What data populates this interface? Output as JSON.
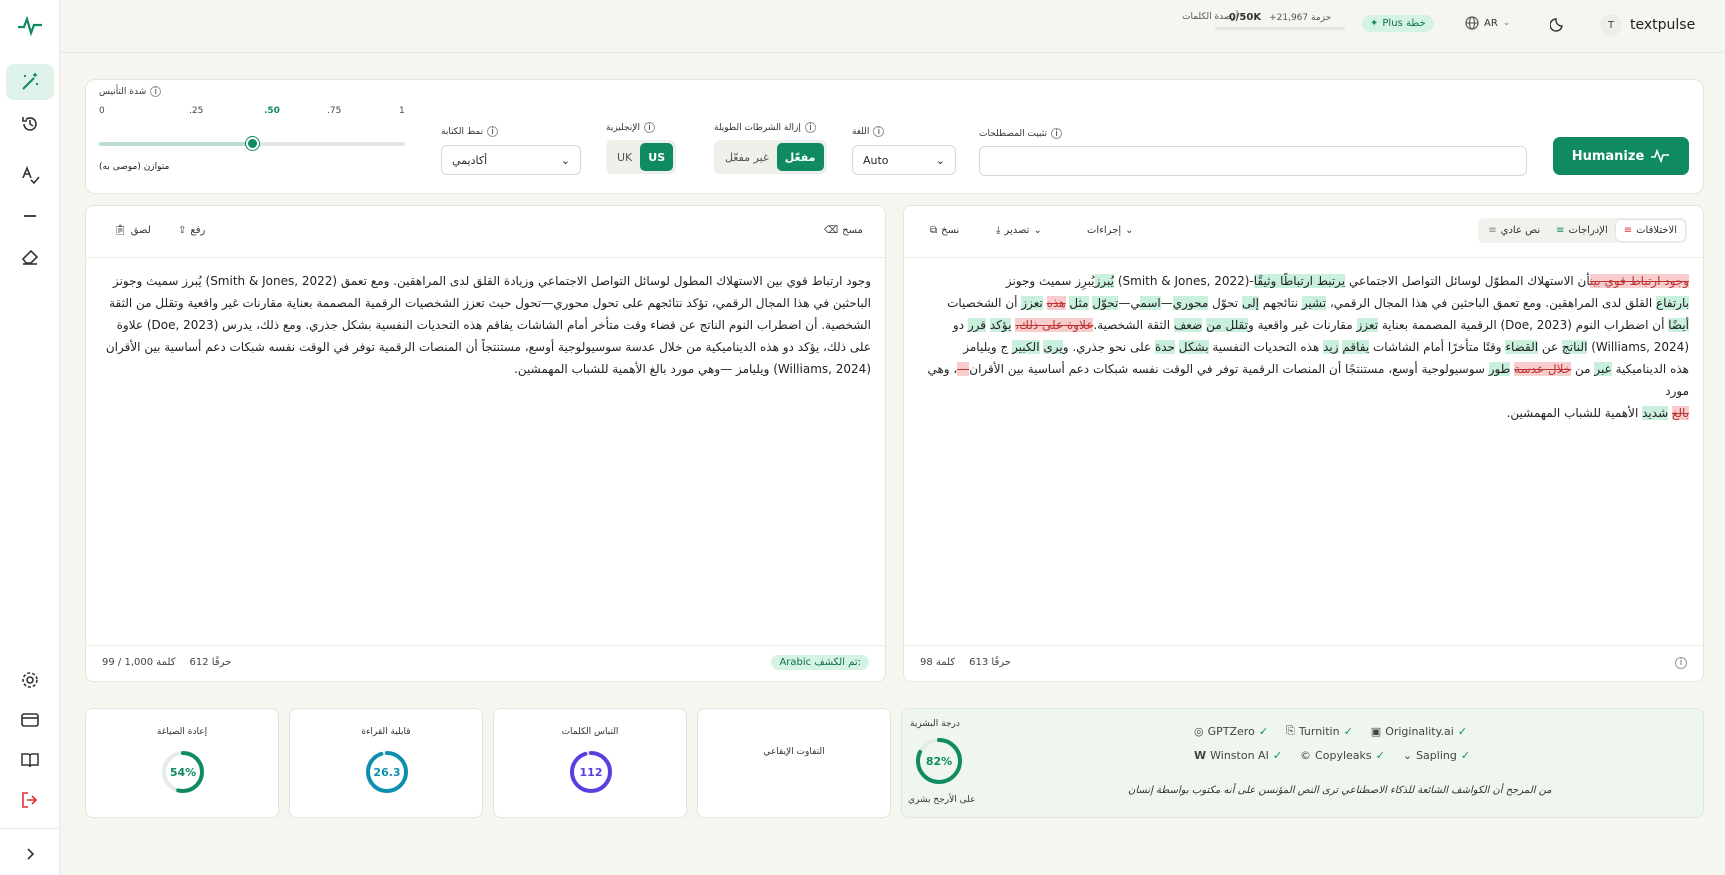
{
  "app": {
    "brand": "textpulse",
    "user_initial": "T"
  },
  "topbar": {
    "lang": "AR",
    "plan": "Plus خطة",
    "bundle": "+21,967 حزمة",
    "words_balance_label": "أرصدة الكلمات",
    "words_balance": "0/50K"
  },
  "settings": {
    "humanize_label": "Humanize",
    "terms_label": "تثبيت المصطلحات",
    "terms_value": "",
    "language_label": "اللغة",
    "language_value": "Auto",
    "dashes_label": "إزالة الشرطات الطويلة",
    "dashes_options": [
      "غير مفعّل",
      "مفعّل"
    ],
    "english_label": "الإنجليزية",
    "english_options": [
      "UK",
      "US"
    ],
    "style_label": "نمط الكتابة",
    "style_value": "أكاديمي",
    "strength_label": "شدة التأنيس",
    "strength_ticks": [
      "0",
      ".25",
      ".50",
      ".75",
      "1"
    ],
    "strength_value": 0.5,
    "strength_caption": "متوازن (موصى به)"
  },
  "output": {
    "tabs": [
      "الاختلافات",
      "الإدراجات",
      "نص عادي"
    ],
    "actions_label": "إجراءات",
    "export_label": "تصدير",
    "copy_label": "نسخ",
    "chars": "613 حرفًا",
    "words": "98 كلمة"
  },
  "input": {
    "clear_label": "مسح",
    "upload_label": "رفع",
    "paste_label": "لصق",
    "text": "وجود ارتباط قوي بين الاستهلاك المطول لوسائل التواصل الاجتماعي وزيادة القلق لدى المراهقين. ومع تعمق (Smith & Jones, 2022) يُبرز سميث وجونز الباحثين في هذا المجال الرقمي، تؤكد نتائجهم على تحول محوري—تحول حيث تعزز الشخصيات الرقمية المصممة بعناية مقارنات غير واقعية وتقلل من الثقة الشخصية. أن اضطراب النوم الناتج عن قضاء وقت متأخر أمام الشاشات يفاقم هذه التحديات النفسية بشكل جذري. ومع ذلك، يدرس (Doe, 2023) علاوة على ذلك، يؤكد دو هذه الديناميكية من خلال عدسة سوسيولوجية أوسع، مستنتجاً أن المنصات الرقمية توفر في الوقت نفسه شبكات دعم أساسية بين الأقران (Williams, 2024) ويليامز —وهي مورد بالغ الأهمية للشباب المهمشين.",
    "detected_label": "تم الكشف:",
    "detected_lang": "Arabic",
    "chars": "612 حرفًا",
    "words": "99 / 1,000 كلمة"
  },
  "output_lines": [
    [
      [
        "del",
        "وجود ارتباط قوي "
      ],
      [
        "del",
        "بين"
      ],
      [
        "",
        "أن الاستهلاك المطوّل لوسائل التواصل الاجتماعي "
      ],
      [
        "add",
        "يرتبط ارتباطًا "
      ],
      [
        "add",
        "وثيقًا"
      ],
      [
        "",
        "-(Smith & Jones, 2022) "
      ],
      [
        "add",
        "يُبرز"
      ],
      [
        "",
        "يُبرِز سميث وجونز"
      ]
    ],
    [
      [
        "add",
        "بارتفاع"
      ],
      [
        "",
        "",
        " القلق لدى المراهقين. ومع تعمق الباحثين في هذا المجال الرقمي، "
      ],
      [
        "add",
        "تشير"
      ],
      [
        "",
        "",
        " نتائجهم "
      ],
      [
        "add",
        "إلى"
      ],
      [
        "",
        "",
        " تحوّل "
      ],
      [
        "add",
        "محوري"
      ],
      [
        "",
        "—"
      ],
      [
        "add",
        "اسم"
      ],
      [
        "",
        "ي—"
      ],
      [
        "add",
        "تحوّل"
      ],
      [
        "",
        "",
        " "
      ],
      [
        "add",
        "مثل"
      ],
      [
        "",
        "",
        " "
      ],
      [
        "del",
        "هذه"
      ],
      [
        "",
        "",
        " "
      ],
      [
        "add",
        "تعزز"
      ],
      [
        "",
        "",
        " أن الشخصيات"
      ]
    ],
    [
      [
        "add",
        "أيضًا"
      ],
      [
        "",
        "",
        " أن اضطراب النوم (Doe, 2023) الرقمية المصممة بعناية "
      ],
      [
        "add",
        "تعزز"
      ],
      [
        "",
        "",
        " مقارنات غير واقعية و"
      ],
      [
        "add",
        "تقلل من"
      ],
      [
        "",
        "",
        " "
      ],
      [
        "add",
        "ضعف"
      ],
      [
        "",
        "",
        " الثقة الشخصية."
      ],
      [
        "del",
        "علاوة على ذلك،"
      ],
      [
        "",
        "",
        " "
      ],
      [
        "add",
        "يؤكد"
      ],
      [
        "",
        "",
        " "
      ],
      [
        "add",
        "قرر"
      ],
      [
        "",
        "",
        " دو"
      ]
    ],
    [
      [
        "",
        "(Williams, 2024) "
      ],
      [
        "add",
        "الناتج"
      ],
      [
        "",
        "",
        " عن "
      ],
      [
        "add",
        "القضاء"
      ],
      [
        "",
        "",
        " وقتًا متأخرًا أمام الشاشات "
      ],
      [
        "add",
        "يفاقم"
      ],
      [
        "",
        "",
        " "
      ],
      [
        "add",
        "زيد"
      ],
      [
        "",
        "",
        " هذه التحديات النفسية "
      ],
      [
        "add",
        "بشكل"
      ],
      [
        "",
        "",
        " "
      ],
      [
        "add",
        "حدة"
      ],
      [
        "",
        "",
        " على نحو جذري. و"
      ],
      [
        "add",
        "يرى"
      ],
      [
        "",
        "",
        " "
      ],
      [
        "add",
        "الكبير"
      ],
      [
        "",
        "",
        " ج ويليامز"
      ]
    ],
    [
      [
        "",
        "هذه الديناميكية "
      ],
      [
        "add",
        "عبر"
      ],
      [
        "",
        "",
        " من "
      ],
      [
        "del",
        "خلال عدسة"
      ],
      [
        "",
        "",
        " "
      ],
      [
        "add",
        "طور"
      ],
      [
        "",
        "",
        " سوسيولوجية أوسع، مستنتجًا أن المنصات الرقمية توفر في الوقت نفسه شبكات دعم أساسية بين الأقران"
      ],
      [
        "del",
        "—"
      ],
      [
        "",
        "، وهي مورد"
      ]
    ],
    [
      [
        "del",
        "بالغ"
      ],
      [
        "",
        "",
        " "
      ],
      [
        "add",
        "شديد"
      ],
      [
        "",
        "",
        " الأهمية للشباب المهمشين."
      ]
    ]
  ],
  "metrics": {
    "rewrite": {
      "label": "إعادة الصياغة",
      "value": "54%",
      "fraction": 0.54,
      "color": "#0f8a63"
    },
    "readability": {
      "label": "قابلية القراءة",
      "value": "26.3",
      "fraction": 0.95,
      "color": "#0f8fb0"
    },
    "variety": {
      "label": "التباس الكلمات",
      "value": "112",
      "fraction": 0.95,
      "color": "#5b3ee0"
    },
    "rhythm": {
      "label": "التفاوت الإيقاعي"
    },
    "human": {
      "label": "درجة البشرية",
      "value": "82%",
      "fraction": 0.82,
      "color": "#0f8a63",
      "caption": "على الأرجح بشري"
    }
  },
  "detectors": [
    {
      "name": "GPTZero",
      "icon": "circle-icon"
    },
    {
      "name": "Turnitin",
      "icon": "doc-icon"
    },
    {
      "name": "Originality.ai",
      "icon": "box-icon"
    },
    {
      "name": "Winston AI",
      "icon": "w-icon"
    },
    {
      "name": "Copyleaks",
      "icon": "c-icon"
    },
    {
      "name": "Sapling",
      "icon": "chevron-icon"
    }
  ],
  "detectors_note": "من المرجح أن الكواشف الشائعة للذكاء الاصطناعي ترى النص المؤنسن على أنه مكتوب بواسطة إنسان"
}
